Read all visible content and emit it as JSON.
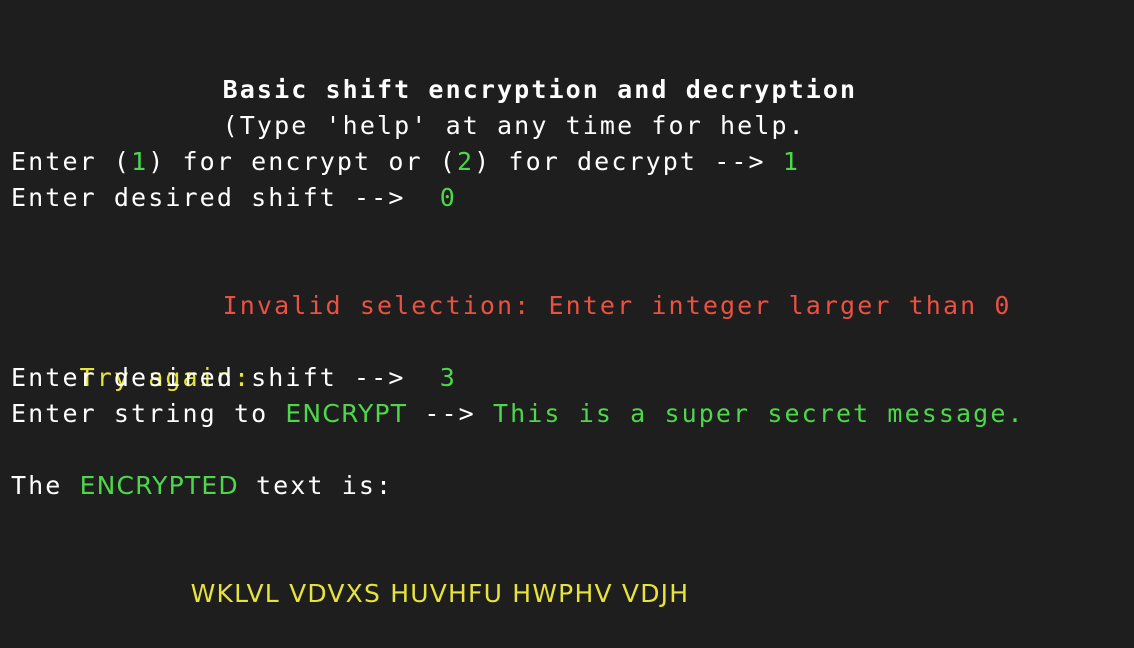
{
  "header": {
    "title": "Basic shift encryption and decryption",
    "help_hint": "(Type 'help' at any time for help."
  },
  "mode_prompt": {
    "part1": "Enter (",
    "option1": "1",
    "part2": ") for encrypt or (",
    "option2": "2",
    "part3": ") for decrypt --> ",
    "answer": "1"
  },
  "shift_prompt_1": {
    "label": "Enter desired shift -->  ",
    "answer": "0"
  },
  "error": {
    "message": "Invalid selection: Enter integer larger than 0"
  },
  "retry": {
    "label": "Try again:"
  },
  "shift_prompt_2": {
    "label": "Enter desired shift -->  ",
    "answer": "3"
  },
  "string_prompt": {
    "part1": "Enter string to ",
    "keyword": "ENCRYPT",
    "part2": " --> ",
    "answer": "This is a super secret message."
  },
  "result": {
    "part1": "The ",
    "keyword": "ENCRYPTED",
    "part2": " text is:",
    "output": "WKLVL VDVXS HUVHFU HWPHV VDJH"
  },
  "colors": {
    "background": "#1e1e1e",
    "text": "#ffffff",
    "input_green": "#4cd84a",
    "error_red": "#ec5040",
    "highlight_yellow": "#e6e33a"
  }
}
